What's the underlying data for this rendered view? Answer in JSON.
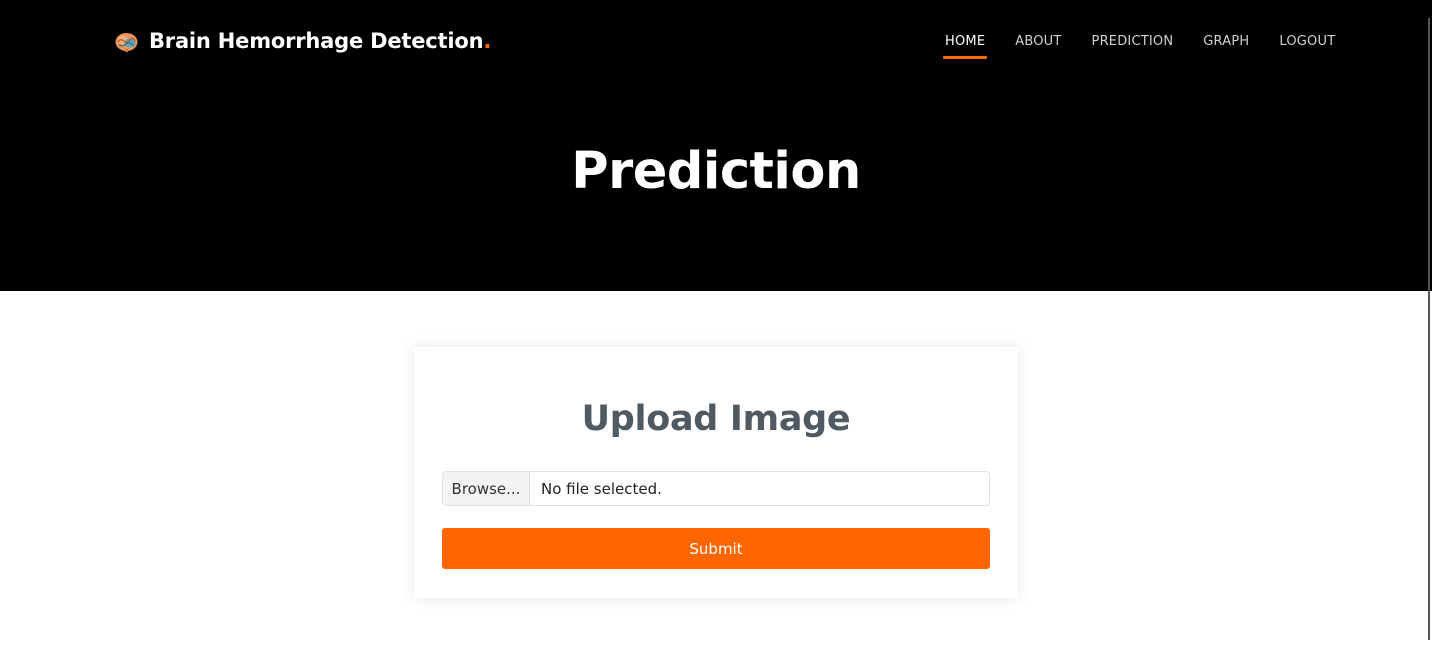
{
  "header": {
    "brand_text": "Brain Hemorrhage Detection",
    "brand_dot": ".",
    "brand_icon": "brain-icon",
    "accent_color": "#ff6a00",
    "nav": [
      {
        "label": "HOME",
        "active": true
      },
      {
        "label": "ABOUT",
        "active": false
      },
      {
        "label": "PREDICTION",
        "active": false
      },
      {
        "label": "GRAPH",
        "active": false
      },
      {
        "label": "LOGOUT",
        "active": false
      }
    ]
  },
  "hero": {
    "title": "Prediction"
  },
  "upload": {
    "title": "Upload Image",
    "browse_label": "Browse...",
    "file_status": "No file selected.",
    "submit_label": "Submit",
    "submit_color": "#ff6600"
  }
}
